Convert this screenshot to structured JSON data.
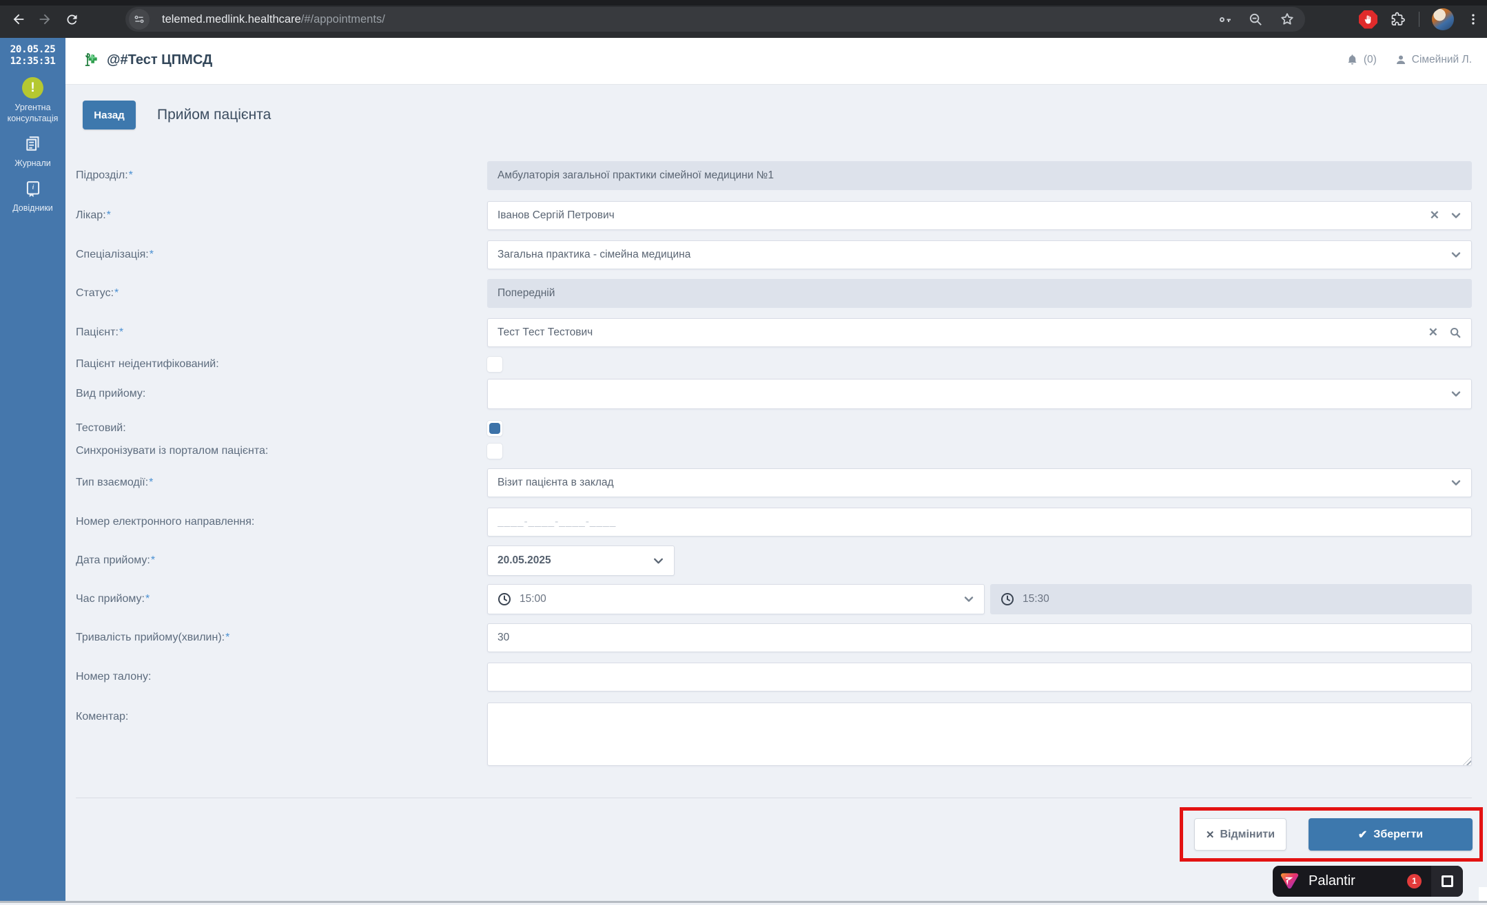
{
  "browser": {
    "url_host": "telemed.medlink.healthcare",
    "url_path": "/#/appointments/"
  },
  "sidebar": {
    "date": "20.05.25",
    "time": "12:35:31",
    "urgent_icon": "!",
    "urgent_label_line1": "Ургентна",
    "urgent_label_line2": "консультація",
    "journals_label": "Журнали",
    "directories_label": "Довідники"
  },
  "header": {
    "org_title": "@#Тест ЦПМСД",
    "notifications_count": "(0)",
    "user_name": "Сімейний Л."
  },
  "page": {
    "back_button": "Назад",
    "title": "Прийом пацієнта"
  },
  "form": {
    "unit": {
      "label": "Підрозділ:",
      "req": "*",
      "value": "Амбулаторія загальної практики сімейної медицини №1"
    },
    "doctor": {
      "label": "Лікар:",
      "req": "*",
      "value": "Іванов Сергій Петрович"
    },
    "specialization": {
      "label": "Спеціалізація:",
      "req": "*",
      "value": "Загальна практика - сімейна медицина"
    },
    "status": {
      "label": "Статус:",
      "req": "*",
      "value": "Попередній"
    },
    "patient": {
      "label": "Пацієнт:",
      "req": "*",
      "value": "Тест Тест Тестович"
    },
    "patient_unidentified": {
      "label": "Пацієнт неідентифікований:",
      "checked": false
    },
    "visit_kind": {
      "label": "Вид прийому:",
      "value": ""
    },
    "test": {
      "label": "Тестовий:",
      "checked": true
    },
    "sync_portal": {
      "label": "Синхронізувати із порталом пацієнта:",
      "checked": false
    },
    "interaction_type": {
      "label": "Тип взаємодії:",
      "req": "*",
      "value": "Візит пацієнта в заклад"
    },
    "referral_number": {
      "label": "Номер електронного направлення:",
      "placeholder": "____-____-____-____"
    },
    "appointment_date": {
      "label": "Дата прийому:",
      "req": "*",
      "value": "20.05.2025"
    },
    "appointment_time": {
      "label": "Час прийому:",
      "req": "*",
      "start": "15:00",
      "end": "15:30"
    },
    "duration": {
      "label": "Тривалість прийому(хвилин):",
      "req": "*",
      "value": "30"
    },
    "ticket_number": {
      "label": "Номер талону:",
      "value": ""
    },
    "comment": {
      "label": "Коментар:",
      "value": ""
    }
  },
  "footer": {
    "cancel_icon": "✕",
    "cancel_label": "Відмінити",
    "save_icon": "✔",
    "save_label": "Зберегти"
  },
  "palantir": {
    "label": "Palantir",
    "badge": "1"
  },
  "colors": {
    "sidebar_blue": "#4577ac",
    "accent_blue": "#3d78ad",
    "annotation_red": "#e31212",
    "urgent_green": "#b5c831",
    "content_bg": "#eef1f6",
    "disabled_bg": "#dde2eb"
  }
}
